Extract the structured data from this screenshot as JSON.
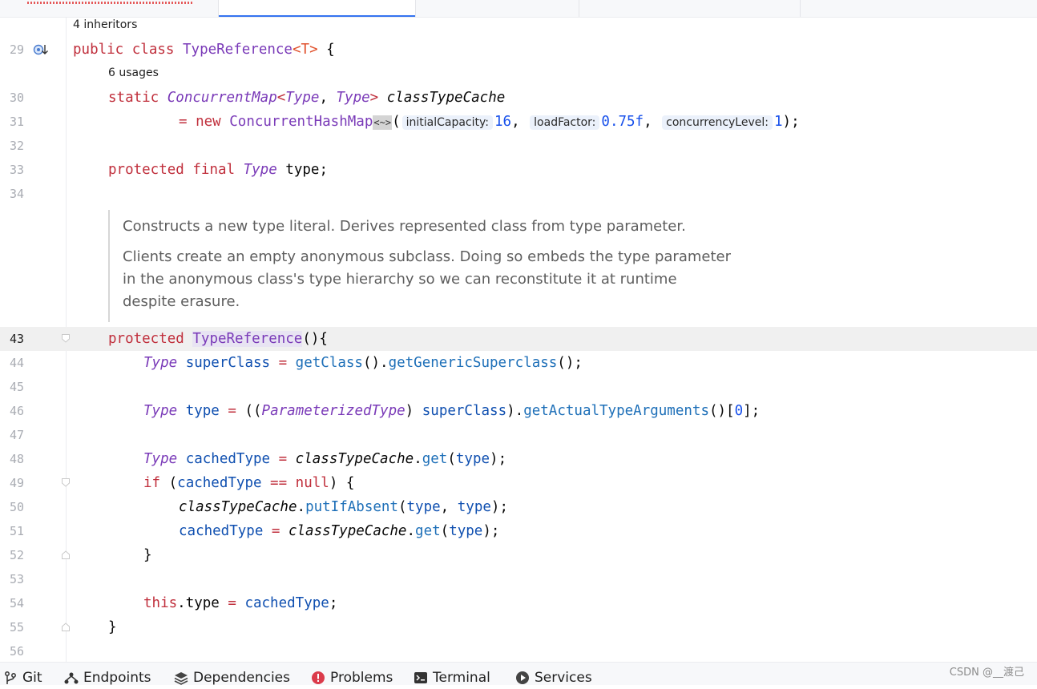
{
  "editor": {
    "inheritors_hint": "4 inheritors",
    "usages_hint": "6 usages",
    "line_numbers": {
      "l29": "29",
      "l30": "30",
      "l31": "31",
      "l32": "32",
      "l33": "33",
      "l34": "34",
      "l43": "43",
      "l44": "44",
      "l45": "45",
      "l46": "46",
      "l47": "47",
      "l48": "48",
      "l49": "49",
      "l50": "50",
      "l51": "51",
      "l52": "52",
      "l53": "53",
      "l54": "54",
      "l55": "55",
      "l56": "56"
    },
    "code": {
      "l29": {
        "kw1": "public",
        "kw2": "class",
        "cls": "TypeReference",
        "lt": "<",
        "tparam": "T",
        "gt": ">",
        "rest": " {"
      },
      "l30": {
        "kw": "static",
        "cls1": "ConcurrentMap",
        "lt": "<",
        "cls2": "Type",
        "comma": ", ",
        "cls3": "Type",
        "gt": ">",
        "field": "classTypeCache"
      },
      "l31": {
        "eq": "=",
        "kw": "new",
        "cls": "ConcurrentHashMap",
        "diamond": "<~>",
        "open": "(",
        "hint1": "initialCapacity:",
        "val1": "16",
        "sep1": ", ",
        "hint2": "loadFactor:",
        "val2": "0.75f",
        "sep2": ", ",
        "hint3": "concurrencyLevel:",
        "val3": "1",
        "close": ");"
      },
      "l33": {
        "kw1": "protected",
        "kw2": "final",
        "cls": "Type",
        "rest": " type;"
      },
      "l43": {
        "kw": "protected",
        "ctor": "TypeReference",
        "rest": "(){"
      },
      "l44": {
        "cls": "Type",
        "var": "superClass",
        "eq": " = ",
        "m1": "getClass",
        "p1": "().",
        "m2": "getGenericSuperclass",
        "p2": "();"
      },
      "l46": {
        "cls": "Type",
        "var": "type",
        "eq": " = ",
        "p1": "((",
        "cls2": "ParameterizedType",
        "p2": ") ",
        "var2": "superClass",
        "p3": ").",
        "m": "getActualTypeArguments",
        "p4": "()[",
        "num": "0",
        "p5": "];"
      },
      "l48": {
        "cls": "Type",
        "var": "cachedType",
        "eq": " = ",
        "field": "classTypeCache",
        "dot": ".",
        "m": "get",
        "p1": "(",
        "arg": "type",
        "p2": ");"
      },
      "l49": {
        "kw": "if",
        "p1": " (",
        "var": "cachedType",
        "op": " == ",
        "kw2": "null",
        "p2": ") {"
      },
      "l50": {
        "field": "classTypeCache",
        "dot": ".",
        "m": "putIfAbsent",
        "p1": "(",
        "a1": "type",
        "sep": ", ",
        "a2": "type",
        "p2": ");"
      },
      "l51": {
        "var": "cachedType",
        "eq": " = ",
        "field": "classTypeCache",
        "dot": ".",
        "m": "get",
        "p1": "(",
        "arg": "type",
        "p2": ");"
      },
      "l52": {
        "rest": "}"
      },
      "l54": {
        "kw": "this",
        "rest1": ".type",
        "eq": " = ",
        "var": "cachedType",
        "rest2": ";"
      },
      "l55": {
        "rest": "}"
      }
    },
    "doc": {
      "p1": "Constructs a new type literal. Derives represented class from type parameter.",
      "p2": "Clients create an empty anonymous subclass. Doing so embeds the type parameter in the anonymous class's type hierarchy so we can reconstitute it at runtime despite erasure."
    }
  },
  "toolbar": {
    "git": "Git",
    "endpoints": "Endpoints",
    "dependencies": "Dependencies",
    "problems": "Problems",
    "terminal": "Terminal",
    "services": "Services"
  },
  "watermark": "CSDN @__渡己"
}
